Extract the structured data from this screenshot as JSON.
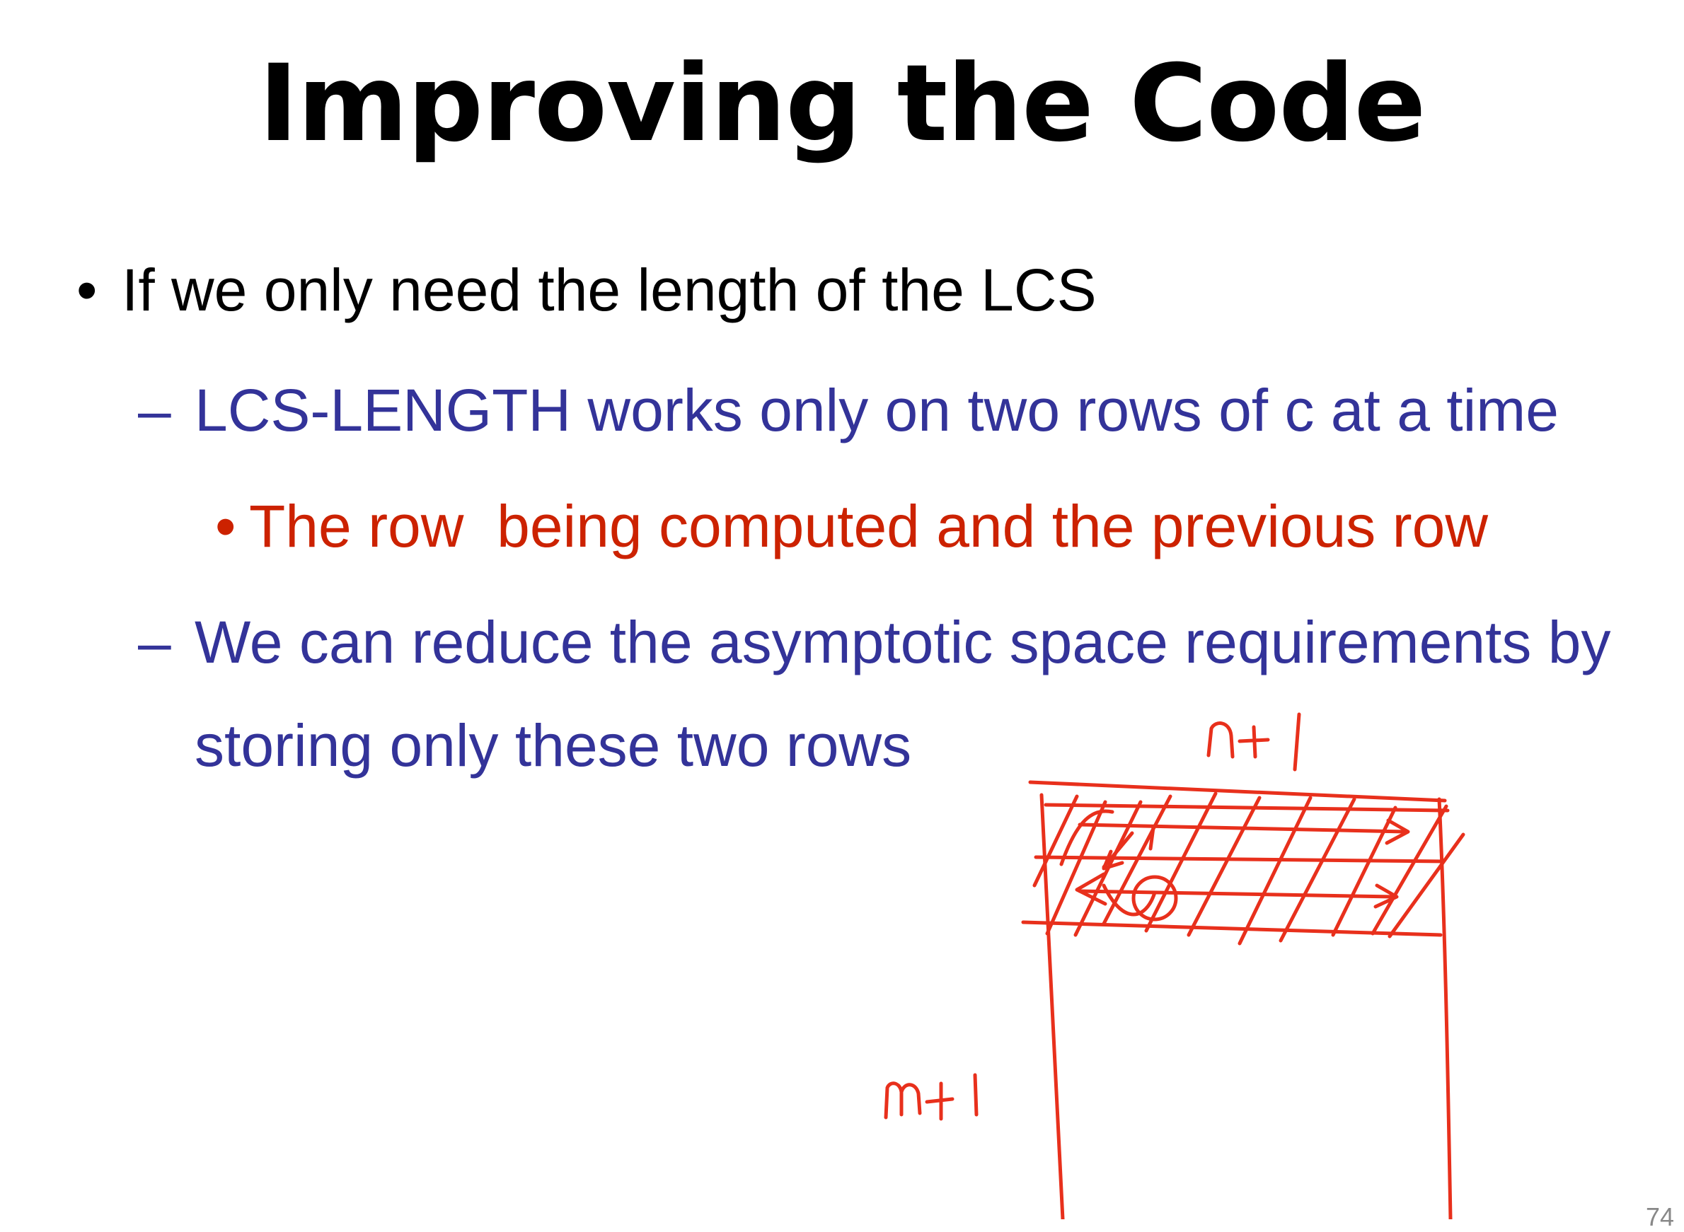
{
  "slide": {
    "title": "Improving the Code",
    "bullets": [
      {
        "level": 1,
        "marker": "•",
        "text": "If we only need the length of the LCS",
        "color": "#000000"
      },
      {
        "level": 2,
        "marker": "–",
        "text": "LCS-LENGTH works only on two rows of c at a time",
        "color": "#333399"
      },
      {
        "level": 3,
        "marker": "•",
        "text": "The row  being computed and the previous row",
        "color": "#cc2200"
      },
      {
        "level": 2,
        "marker": "–",
        "text": "We can reduce the asymptotic space requirements by",
        "continuation": "storing only these two rows",
        "color": "#333399"
      }
    ],
    "page_number": "74"
  },
  "annotation": {
    "color": "#e8301c",
    "table_width_label": "n+1",
    "table_height_label": "m+1"
  }
}
